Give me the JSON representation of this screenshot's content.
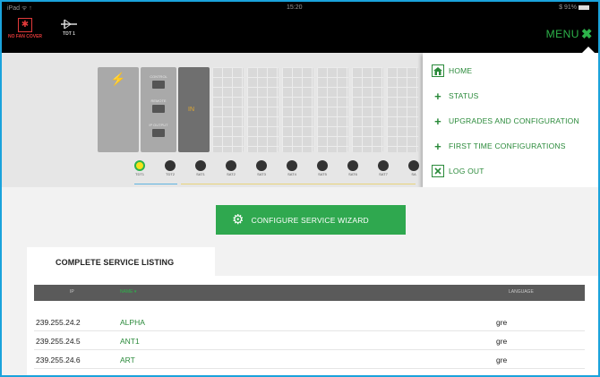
{
  "status_bar": {
    "carrier": "iPad ᯤ ↑",
    "time": "15:20",
    "battery": "$ 91%"
  },
  "header": {
    "alert_icon": "fan-alert-icon",
    "alert_label": "NO FAN COVER",
    "source_icon": "antenna-icon",
    "source_label": "TDT 1",
    "menu_label": "MENU",
    "menu_close_icon": "close-icon",
    "accent_color": "#2db34a"
  },
  "device": {
    "power_icon": "lightning-bolt-icon",
    "ports": [
      "CONTROL",
      "REMOTE",
      "IP OUTPUT"
    ],
    "input_slot_label": "IN",
    "inputs": [
      "TDT1",
      "TDT2",
      "SAT1",
      "SAT2",
      "SAT3",
      "SAT4",
      "SAT5",
      "SAT6",
      "SAT7",
      "SA"
    ]
  },
  "menu": {
    "items": [
      {
        "label": "HOME",
        "icon": "home-icon"
      },
      {
        "label": "STATUS",
        "icon": "plus-icon"
      },
      {
        "label": "UPGRADES AND CONFIGURATION",
        "icon": "plus-icon"
      },
      {
        "label": "FIRST TIME CONFIGURATIONS",
        "icon": "plus-icon"
      },
      {
        "label": "LOG OUT",
        "icon": "close-box-icon"
      }
    ]
  },
  "wizard": {
    "label": "CONFIGURE SERVICE WIZARD",
    "icon": "gear-icon"
  },
  "listing": {
    "tab_label": "COMPLETE SERVICE LISTING",
    "columns": {
      "ip": "IP",
      "name": "NAME ▾",
      "language": "LANGUAGE"
    },
    "rows": [
      {
        "ip": "239.255.24.2",
        "name": "ALPHA",
        "language": "gre"
      },
      {
        "ip": "239.255.24.5",
        "name": "ANT1",
        "language": "gre"
      },
      {
        "ip": "239.255.24.6",
        "name": "ART",
        "language": "gre"
      }
    ]
  }
}
